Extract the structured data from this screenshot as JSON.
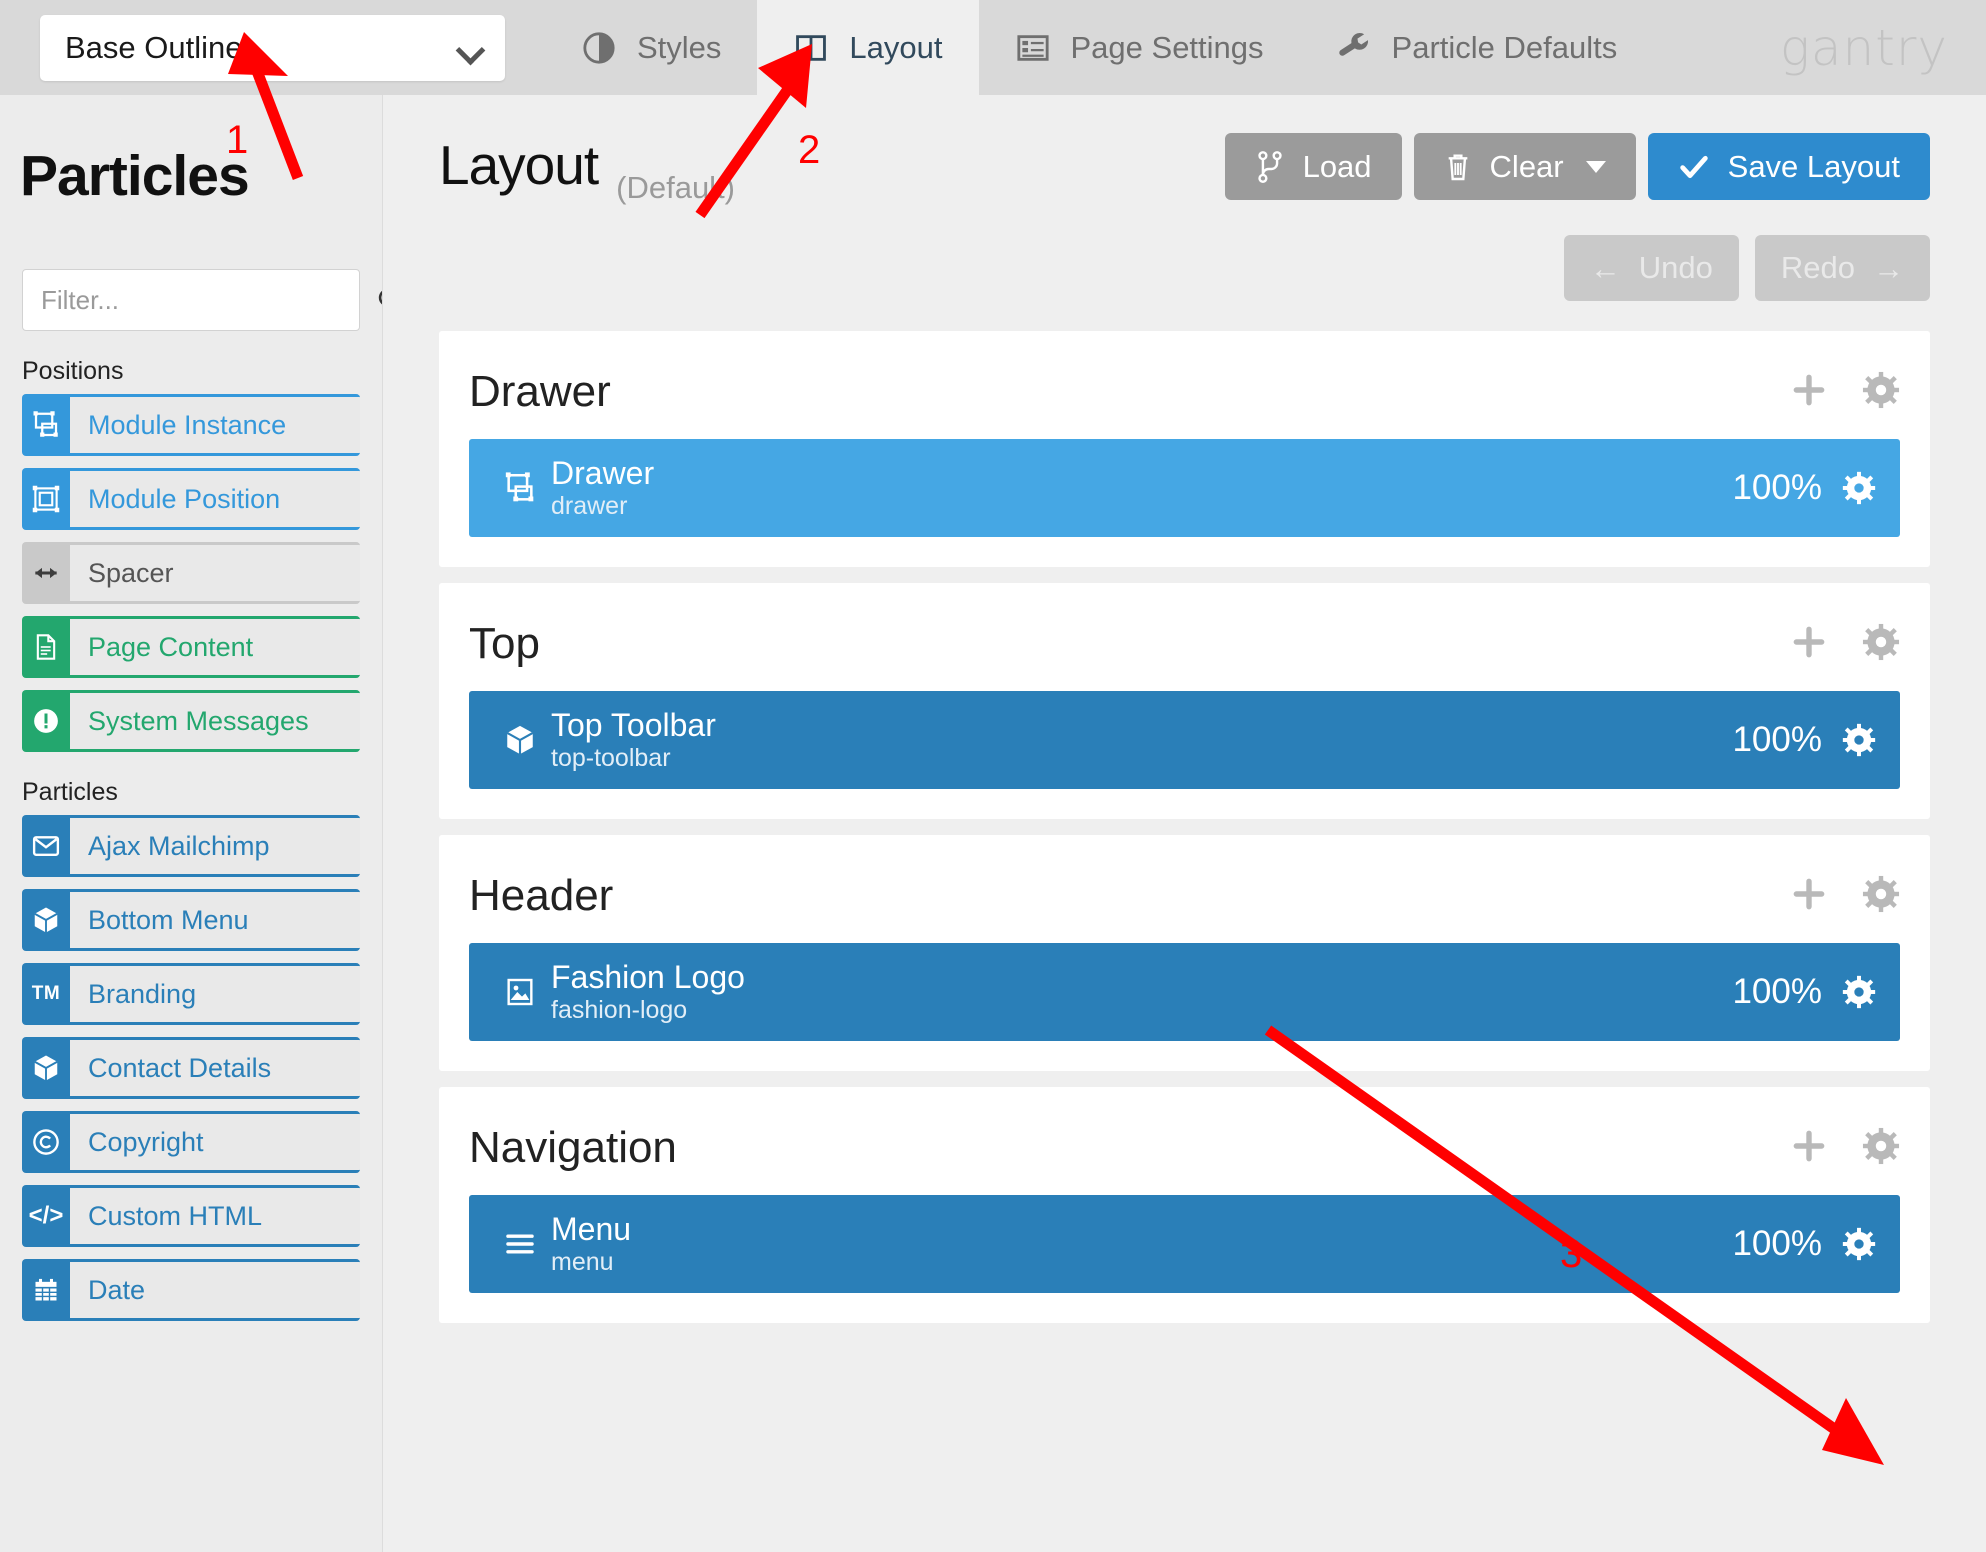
{
  "topbar": {
    "outline_select": {
      "value": "Base Outline",
      "icon": "chevron-down-icon"
    },
    "tabs": [
      {
        "id": "styles",
        "label": "Styles",
        "icon": "contrast-icon",
        "active": false
      },
      {
        "id": "layout",
        "label": "Layout",
        "icon": "columns-icon",
        "active": true
      },
      {
        "id": "page-settings",
        "label": "Page Settings",
        "icon": "list-alt-icon",
        "active": false
      },
      {
        "id": "particle-defaults",
        "label": "Particle Defaults",
        "icon": "wrench-icon",
        "active": false
      }
    ],
    "brand": "gantry"
  },
  "sidebar": {
    "title": "Particles",
    "filter": {
      "placeholder": "Filter...",
      "value": "",
      "icon": "search-icon"
    },
    "groups": [
      {
        "label": "Positions",
        "items": [
          {
            "label": "Module Instance",
            "icon": "module-instance-icon",
            "color": "blue"
          },
          {
            "label": "Module Position",
            "icon": "module-position-icon",
            "color": "blue"
          },
          {
            "label": "Spacer",
            "icon": "arrows-h-icon",
            "color": "grey"
          },
          {
            "label": "Page Content",
            "icon": "file-text-icon",
            "color": "green"
          },
          {
            "label": "System Messages",
            "icon": "exclamation-circle-icon",
            "color": "green"
          }
        ]
      },
      {
        "label": "Particles",
        "items": [
          {
            "label": "Ajax Mailchimp",
            "icon": "envelope-icon",
            "color": "dblue"
          },
          {
            "label": "Bottom Menu",
            "icon": "cube-icon",
            "color": "dblue"
          },
          {
            "label": "Branding",
            "icon": "trademark-icon",
            "color": "dblue"
          },
          {
            "label": "Contact Details",
            "icon": "cube-icon",
            "color": "dblue"
          },
          {
            "label": "Copyright",
            "icon": "copyright-icon",
            "color": "dblue"
          },
          {
            "label": "Custom HTML",
            "icon": "code-icon",
            "color": "dblue"
          },
          {
            "label": "Date",
            "icon": "calendar-icon",
            "color": "dblue"
          }
        ]
      }
    ]
  },
  "main": {
    "title": "Layout",
    "subtitle": "(Default)",
    "actions": [
      {
        "id": "load",
        "label": "Load",
        "icon": "code-fork-icon",
        "style": "grey"
      },
      {
        "id": "clear",
        "label": "Clear",
        "icon": "trash-icon",
        "style": "grey",
        "caret": true
      },
      {
        "id": "save-layout",
        "label": "Save Layout",
        "icon": "check-icon",
        "style": "primary"
      }
    ],
    "history": [
      {
        "id": "undo",
        "label": "Undo",
        "icon": "arrow-left-icon",
        "disabled": true
      },
      {
        "id": "redo",
        "label": "Redo",
        "icon": "arrow-right-icon",
        "disabled": true
      }
    ],
    "sections": [
      {
        "name": "Drawer",
        "tools": [
          "plus-icon",
          "gear-icon"
        ],
        "blocks": [
          {
            "title": "Drawer",
            "subtitle": "drawer",
            "size": "100%",
            "icon": "module-instance-icon",
            "shade": "light"
          }
        ]
      },
      {
        "name": "Top",
        "tools": [
          "plus-icon",
          "gear-icon"
        ],
        "blocks": [
          {
            "title": "Top Toolbar",
            "subtitle": "top-toolbar",
            "size": "100%",
            "icon": "cube-icon",
            "shade": "dark"
          }
        ]
      },
      {
        "name": "Header",
        "tools": [
          "plus-icon",
          "gear-icon"
        ],
        "blocks": [
          {
            "title": "Fashion Logo",
            "subtitle": "fashion-logo",
            "size": "100%",
            "icon": "image-icon",
            "shade": "dark"
          }
        ]
      },
      {
        "name": "Navigation",
        "tools": [
          "plus-icon",
          "gear-icon"
        ],
        "blocks": [
          {
            "title": "Menu",
            "subtitle": "menu",
            "size": "100%",
            "icon": "bars-icon",
            "shade": "dark"
          }
        ]
      }
    ]
  },
  "annotations": {
    "color": "#ff0000",
    "markers": [
      {
        "number": "1",
        "target": "outline-select"
      },
      {
        "number": "2",
        "target": "tab-layout"
      },
      {
        "number": "3",
        "target": "menu-block-gear"
      }
    ]
  }
}
